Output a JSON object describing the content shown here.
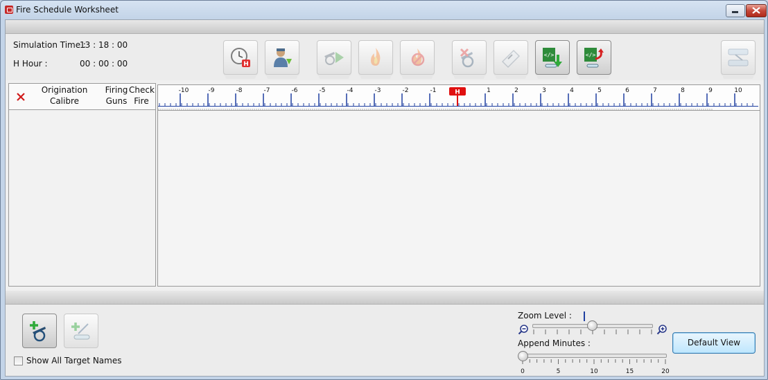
{
  "window": {
    "title": "Fire Schedule Worksheet"
  },
  "info": {
    "sim_time_label": "Simulation Time :",
    "sim_time_value": "13 : 18 : 00",
    "h_hour_label": "H Hour :",
    "h_hour_value": "00 : 00 : 00"
  },
  "toolbar": {
    "buttons": [
      {
        "icon": "h-hour-clock-icon",
        "state": "enabled"
      },
      {
        "icon": "officer-download-icon",
        "state": "enabled"
      },
      {
        "icon": "gun-play-icon",
        "state": "disabled"
      },
      {
        "icon": "fire-icon",
        "state": "disabled"
      },
      {
        "icon": "no-fire-icon",
        "state": "disabled"
      },
      {
        "icon": "gun-delete-icon",
        "state": "disabled"
      },
      {
        "icon": "edit-tag-icon",
        "state": "disabled"
      },
      {
        "icon": "xml-export-icon",
        "state": "active"
      },
      {
        "icon": "xml-import-icon",
        "state": "active"
      },
      {
        "icon": "layout-icon",
        "state": "disabled"
      }
    ]
  },
  "columns": {
    "origination": "Origination",
    "calibre": "Calibre",
    "firing": "Firing",
    "guns": "Guns",
    "check": "Check",
    "fire": "Fire"
  },
  "timeline": {
    "labels": [
      "-10",
      "-9",
      "-8",
      "-7",
      "-6",
      "-5",
      "-4",
      "-3",
      "-2",
      "-1",
      "H",
      "1",
      "2",
      "3",
      "4",
      "5",
      "6",
      "7",
      "8",
      "9",
      "10"
    ],
    "marker_label": "H",
    "marker_color": "#e01010"
  },
  "bottom": {
    "show_all_label": "Show All Target Names",
    "show_all_checked": false,
    "zoom_label": "Zoom Level :",
    "zoom_level": 0.5,
    "append_label": "Append Minutes :",
    "append_ticks": [
      "0",
      "5",
      "10",
      "15",
      "20"
    ],
    "append_value": 0,
    "default_view": "Default View"
  },
  "colors": {
    "accent": "#1e3fa0",
    "hour_marker": "#e01010"
  }
}
